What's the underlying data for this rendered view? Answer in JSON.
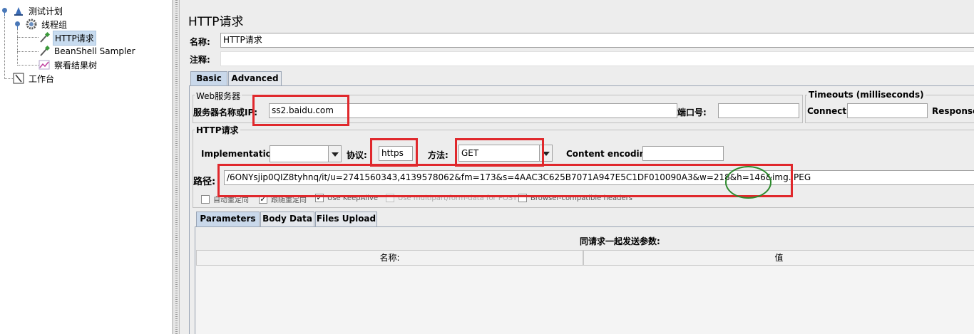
{
  "tree": {
    "items": [
      {
        "label": "测试计划",
        "icon": "test-plan-icon"
      },
      {
        "label": "线程组",
        "icon": "gear-icon"
      },
      {
        "label": "HTTP请求",
        "icon": "pipette-sampler-icon",
        "selected": true
      },
      {
        "label": "BeanShell Sampler",
        "icon": "pipette-sampler-icon"
      },
      {
        "label": "察看结果树",
        "icon": "listener-chart-icon"
      },
      {
        "label": "工作台",
        "icon": "workbench-icon"
      }
    ]
  },
  "panel": {
    "title": "HTTP请求",
    "name_label": "名称:",
    "name_value": "HTTP请求",
    "comment_label": "注释:",
    "comment_value": ""
  },
  "tabs": [
    "Basic",
    "Advanced"
  ],
  "web_server": {
    "legend": "Web服务器",
    "server_label": "服务器名称或IP:",
    "server_value": "ss2.baidu.com",
    "port_label": "端口号:",
    "port_value": ""
  },
  "timeouts": {
    "legend": "Timeouts (milliseconds)",
    "connect_label": "Connect:",
    "connect_value": "",
    "response_label": "Response:"
  },
  "http_request": {
    "legend": "HTTP请求",
    "implementation_label": "Implementation:",
    "implementation_value": "",
    "protocol_label": "协议:",
    "protocol_value": "https",
    "method_label": "方法:",
    "method_value": "GET",
    "encoding_label": "Content encoding:",
    "encoding_value": "",
    "path_label": "路径:",
    "path_value": "/6ONYsjip0QIZ8tyhnq/it/u=2741560343,4139578062&fm=173&s=4AAC3C625B7071A947E5C1DF010090A3&w=218&h=146&img.JPEG"
  },
  "checkboxes": [
    {
      "label": "自动重定向",
      "checked": false,
      "disabled": false
    },
    {
      "label": "跟随重定向",
      "checked": true,
      "disabled": false
    },
    {
      "label": "Use KeepAlive",
      "checked": true,
      "disabled": false
    },
    {
      "label": "Use multipart/form-data for POST",
      "checked": false,
      "disabled": true
    },
    {
      "label": "Browser-compatible headers",
      "checked": false,
      "disabled": false
    }
  ],
  "sub_tabs": [
    "Parameters",
    "Body Data",
    "Files Upload"
  ],
  "parameters": {
    "caption": "同请求一起发送参数:",
    "columns": [
      "名称:",
      "值"
    ]
  },
  "annotation_colors": {
    "red": "#e0282c",
    "green": "#2d8a2d"
  }
}
